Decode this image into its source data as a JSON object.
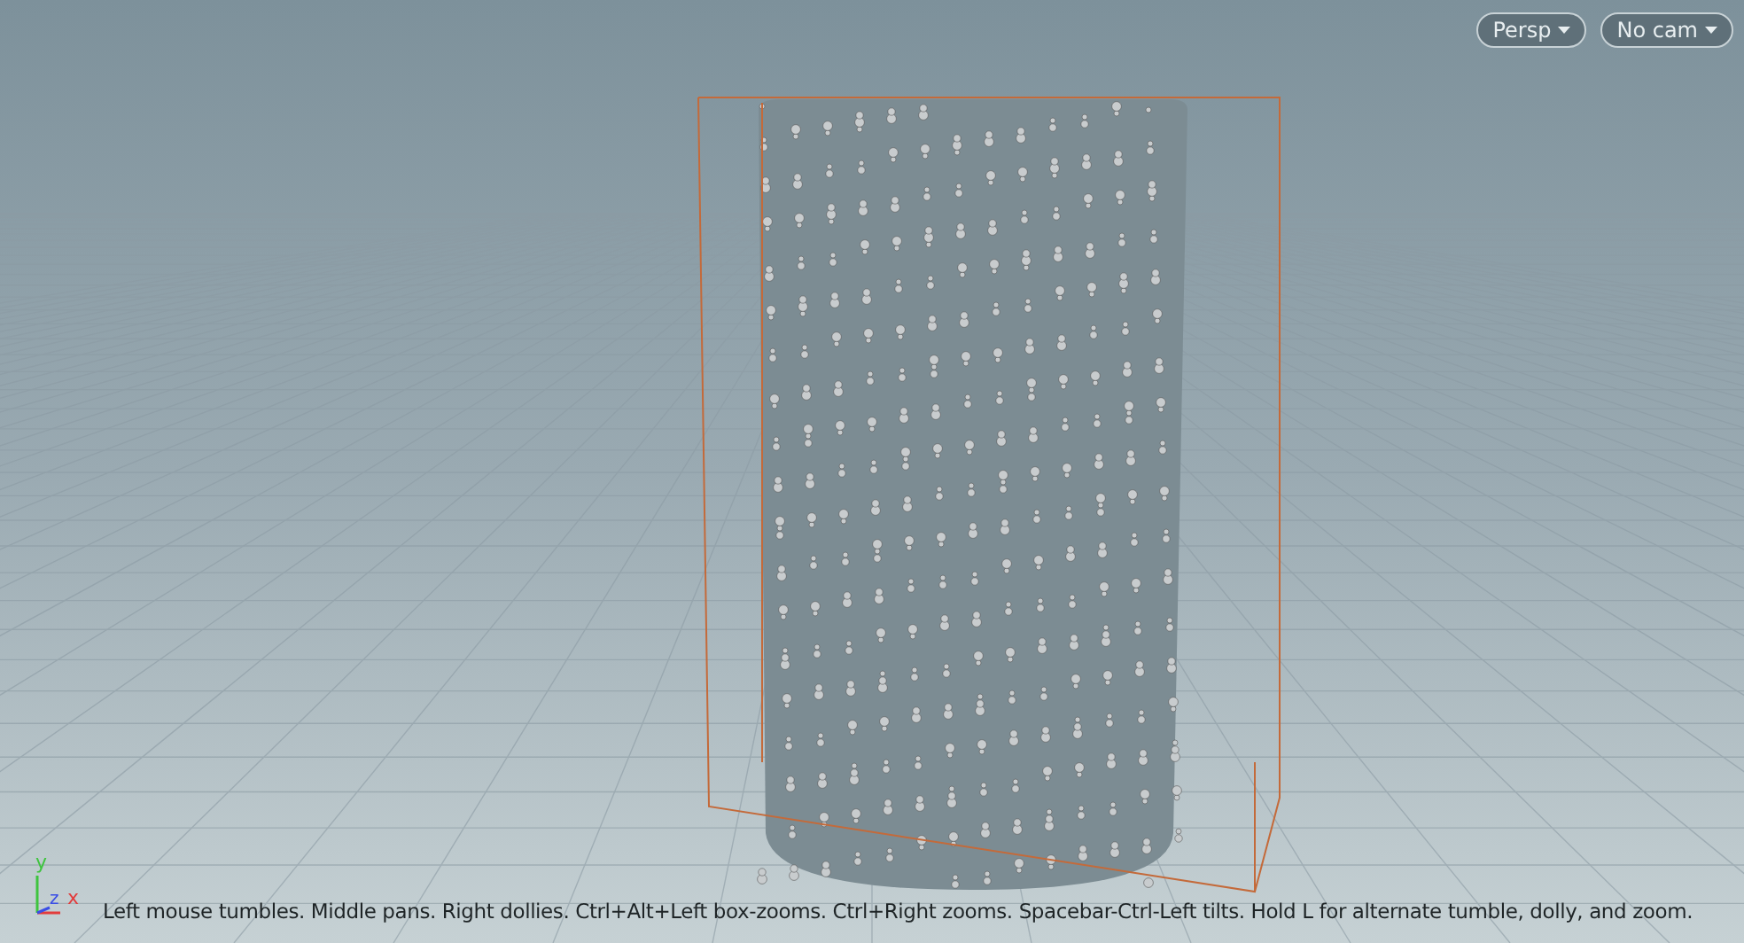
{
  "view_menus": [
    {
      "label": "Persp"
    },
    {
      "label": "No cam"
    }
  ],
  "axes": {
    "y": "y",
    "z": "z",
    "x": "x"
  },
  "hint": "Left mouse tumbles. Middle pans. Right dollies. Ctrl+Alt+Left box-zooms. Ctrl+Right zooms. Spacebar-Ctrl-Left tilts. Hold L for alternate tumble, dolly, and zoom."
}
